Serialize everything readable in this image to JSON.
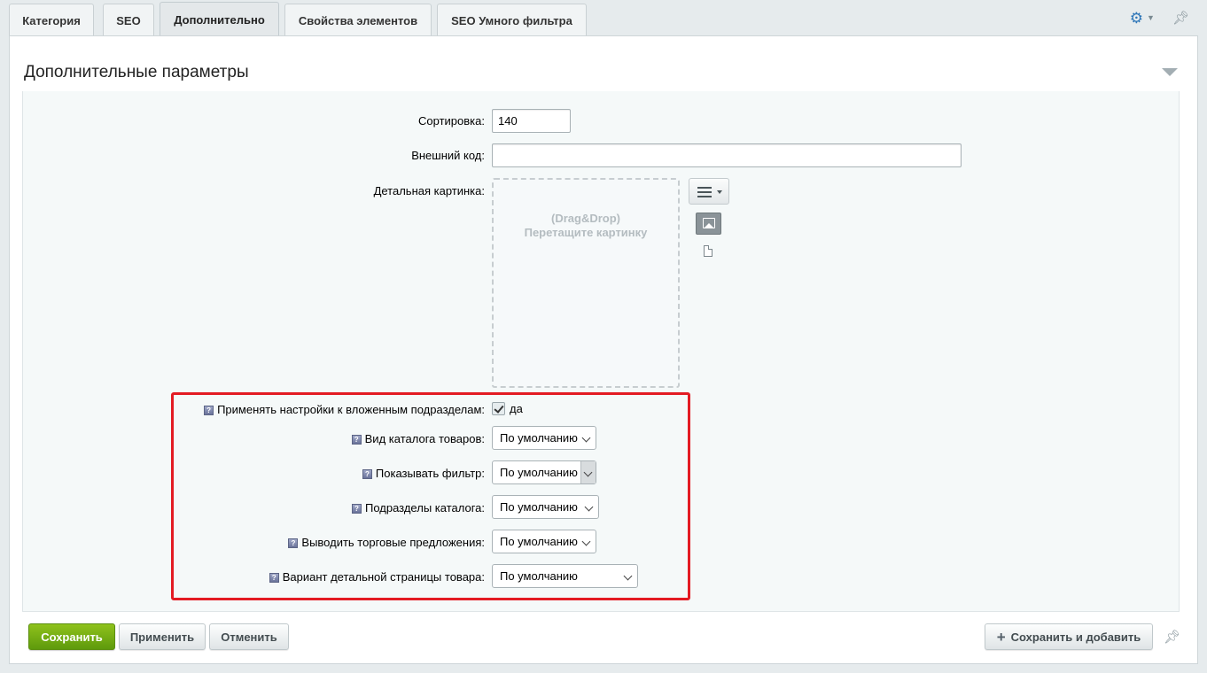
{
  "tabs": [
    {
      "label": "Категория",
      "active": false
    },
    {
      "label": "SEO",
      "active": false
    },
    {
      "label": "Дополнительно",
      "active": true
    },
    {
      "label": "Свойства элементов",
      "active": false
    },
    {
      "label": "SEO Умного фильтра",
      "active": false
    }
  ],
  "header_icons": {
    "settings": "gear-icon",
    "pin": "pin-icon"
  },
  "section": {
    "title": "Дополнительные параметры"
  },
  "fields": {
    "sort": {
      "label": "Сортировка:",
      "value": "140"
    },
    "external_code": {
      "label": "Внешний код:",
      "value": ""
    },
    "detail_picture": {
      "label": "Детальная картинка:",
      "dropzone_line1": "(Drag&Drop)",
      "dropzone_line2": "Перетащите картинку"
    },
    "apply_nested": {
      "label": "Применять настройки к вложенным подразделам:",
      "checked": true,
      "checkbox_text": "да"
    },
    "catalog_view": {
      "label": "Вид каталога товаров:",
      "value": "По умолчанию"
    },
    "show_filter": {
      "label": "Показывать фильтр:",
      "value": "По умолчанию"
    },
    "catalog_sections": {
      "label": "Подразделы каталога:",
      "value": "По умолчанию"
    },
    "show_offers": {
      "label": "Выводить торговые предложения:",
      "value": "По умолчанию"
    },
    "detail_page_variant": {
      "label": "Вариант детальной страницы товара:",
      "value": "По умолчанию"
    }
  },
  "highlight_color": "#e31b23",
  "buttons": {
    "save": "Сохранить",
    "apply": "Применить",
    "cancel": "Отменить",
    "save_and_add": "Сохранить и добавить"
  },
  "colors": {
    "save_button": "#6fae12",
    "accent": "#2e76b8"
  }
}
